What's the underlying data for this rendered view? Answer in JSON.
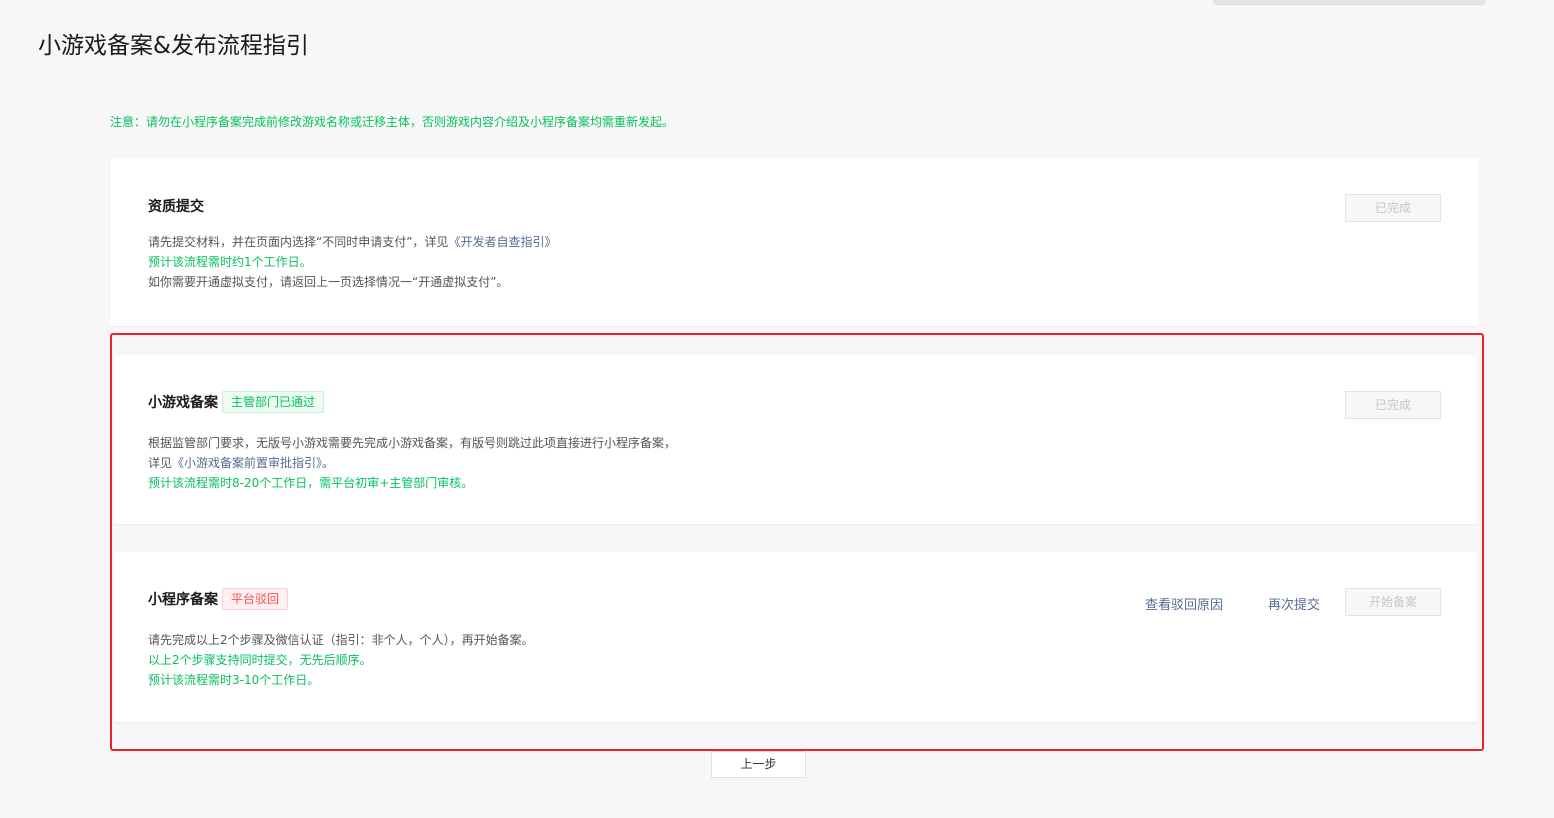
{
  "page": {
    "title": "小游戏备案&发布流程指引",
    "notice": "注意：请勿在小程序备案完成前修改游戏名称或迁移主体，否则游戏内容介绍及小程序备案均需重新发起。"
  },
  "steps": [
    {
      "title": "资质提交",
      "badge": "",
      "desc_lead": "请先提交材料，并在页面内选择“不同时申请支付”，详见",
      "desc_link": "《开发者自查指引》",
      "desc_green": "预计该流程需时约1个工作日。",
      "desc_extra": "如你需要开通虚拟支付，请返回上一页选择情况一“开通虚拟支付”。",
      "button_label": "已完成"
    },
    {
      "title": "小游戏备案",
      "badge": "主管部门已通过",
      "desc_line1": "根据监管部门要求，无版号小游戏需要先完成小游戏备案，有版号则跳过此项直接进行小程序备案，",
      "desc_lead": "详见",
      "desc_link": "《小游戏备案前置审批指引》",
      "desc_tail": "。",
      "desc_green": "预计该流程需时8-20个工作日，需平台初审+主管部门审核。",
      "button_label": "已完成"
    },
    {
      "title": "小程序备案",
      "badge": "平台驳回",
      "desc_line1": "请先完成以上2个步骤及微信认证（指引：非个人，个人），再开始备案。",
      "desc_green1": "以上2个步骤支持同时提交，无先后顺序。",
      "desc_green2": "预计该流程需时3-10个工作日。",
      "link_reason": "查看驳回原因",
      "link_resubmit": "再次提交",
      "button_label": "开始备案"
    }
  ],
  "footer": {
    "prev_label": "上一步"
  },
  "colors": {
    "accent_green": "#07c160",
    "link_blue": "#576b95",
    "reject_red": "#fa5151",
    "highlight_border": "#e8232e"
  }
}
